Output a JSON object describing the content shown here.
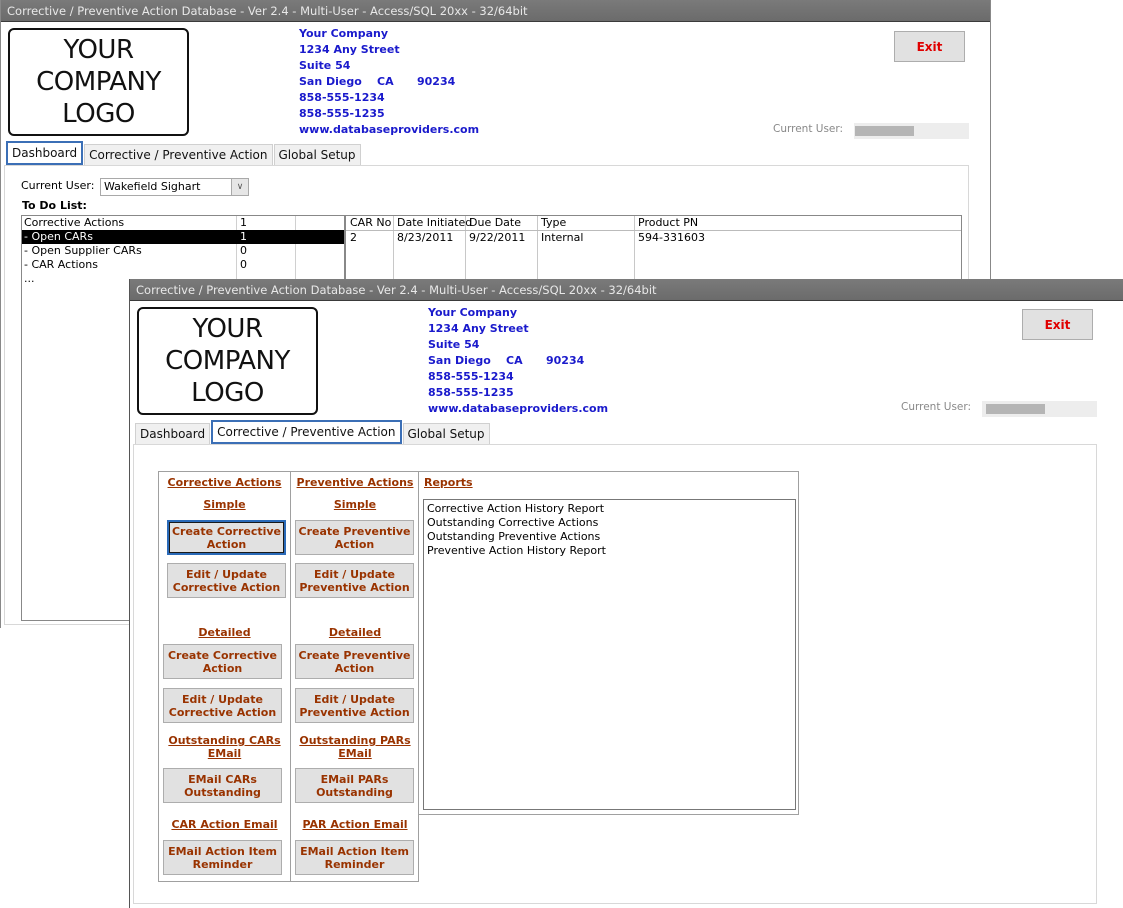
{
  "app": {
    "title": "Corrective / Preventive Action Database - Ver 2.4  - Multi-User - Access/SQL 20xx - 32/64bit"
  },
  "logo": {
    "lines": [
      "YOUR",
      "COMPANY",
      "LOGO"
    ]
  },
  "company": {
    "name": "Your Company",
    "street": "1234 Any Street",
    "suite": "Suite 54",
    "city": "San Diego",
    "state": "CA",
    "zip": "90234",
    "phone1": "858-555-1234",
    "phone2": "858-555-1235",
    "website": "www.databaseproviders.com"
  },
  "header": {
    "exit_label": "Exit",
    "current_user_label": "Current User:"
  },
  "tabs": [
    {
      "label": "Dashboard"
    },
    {
      "label": "Corrective / Preventive Action"
    },
    {
      "label": "Global Setup"
    }
  ],
  "dashboard": {
    "current_user_label": "Current User:",
    "current_user_value": "Wakefield Sighart",
    "todo_title": "To Do List:",
    "todo_rows": [
      {
        "label": "Corrective Actions",
        "count": "1",
        "selected": false
      },
      {
        "label": " - Open CARs",
        "count": "1",
        "selected": true
      },
      {
        "label": " - Open Supplier CARs",
        "count": "0",
        "selected": false
      },
      {
        "label": " - CAR Actions",
        "count": "0",
        "selected": false
      },
      {
        "label": "...",
        "count": "",
        "selected": false
      }
    ],
    "car_table": {
      "columns": [
        "CAR No",
        "Date Initiated",
        "Due Date",
        "Type",
        "Product PN"
      ],
      "rows": [
        [
          "2",
          "8/23/2011",
          "9/22/2011",
          "Internal",
          "594-331603"
        ]
      ]
    }
  },
  "cpa": {
    "corrective": {
      "heading": "Corrective Actions",
      "simple": "Simple",
      "create_simple": "Create Corrective Action",
      "edit_simple": "Edit / Update Corrective Action",
      "detailed": "Detailed",
      "create_detailed": "Create Corrective Action",
      "edit_detailed": "Edit / Update Corrective Action",
      "outstanding_heading_1": "Outstanding CARs",
      "outstanding_heading_2": "EMail",
      "email_outstanding": "EMail CARs Outstanding",
      "action_email_heading": "CAR Action Email",
      "email_reminder": "EMail Action Item Reminder"
    },
    "preventive": {
      "heading": "Preventive Actions",
      "simple": "Simple",
      "create_simple": "Create Preventive Action",
      "edit_simple": "Edit / Update Preventive Action",
      "detailed": "Detailed",
      "create_detailed": "Create Preventive Action",
      "edit_detailed": "Edit / Update Preventive Action",
      "outstanding_heading_1": "Outstanding PARs",
      "outstanding_heading_2": "EMail",
      "email_outstanding": "EMail PARs Outstanding",
      "action_email_heading": "PAR Action Email",
      "email_reminder": "EMail Action Item Reminder"
    },
    "reports": {
      "heading": "Reports",
      "items": [
        "Corrective Action History Report",
        "Outstanding Corrective Actions",
        "Outstanding Preventive Actions",
        "Preventive Action History Report"
      ]
    }
  },
  "colors": {
    "address_blue": "#1a1acc",
    "link_brown": "#993300",
    "exit_red": "#e00000",
    "active_tab_border": "#3b6fb6",
    "titlebar": "#707070"
  }
}
